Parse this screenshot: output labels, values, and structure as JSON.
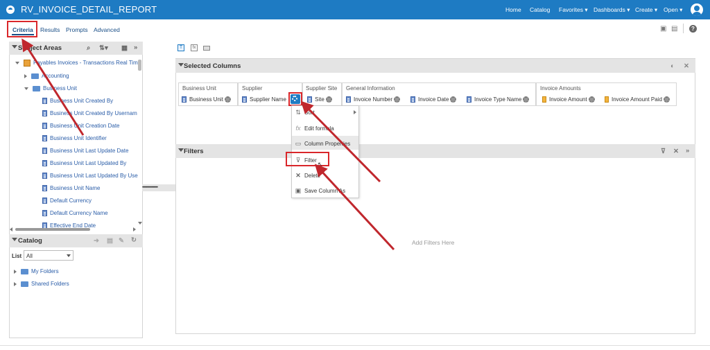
{
  "header": {
    "title": "RV_INVOICE_DETAIL_REPORT",
    "nav": [
      "Home",
      "Catalog",
      "Favorites ▾",
      "Dashboards ▾",
      "Create ▾",
      "Open ▾"
    ]
  },
  "tabs": [
    "Criteria",
    "Results",
    "Prompts",
    "Advanced"
  ],
  "subject_areas": {
    "title": "Subject Areas",
    "root": "Payables Invoices - Transactions Real Tim",
    "items": [
      {
        "label": "Accounting",
        "type": "folder",
        "expanded": false
      },
      {
        "label": "Business Unit",
        "type": "folder",
        "expanded": true
      },
      {
        "label": "Business Unit Created By",
        "type": "column"
      },
      {
        "label": "Business Unit Created By Usernam",
        "type": "column"
      },
      {
        "label": "Business Unit Creation Date",
        "type": "column"
      },
      {
        "label": "Business Unit Identifier",
        "type": "column"
      },
      {
        "label": "Business Unit Last Update Date",
        "type": "column"
      },
      {
        "label": "Business Unit Last Updated By",
        "type": "column"
      },
      {
        "label": "Business Unit Last Updated By Use",
        "type": "column"
      },
      {
        "label": "Business Unit Name",
        "type": "column"
      },
      {
        "label": "Default Currency",
        "type": "column"
      },
      {
        "label": "Default Currency Name",
        "type": "column"
      },
      {
        "label": "Effective End Date",
        "type": "column"
      }
    ]
  },
  "catalog": {
    "title": "Catalog",
    "list_label": "List",
    "list_value": "All",
    "folders": [
      "My Folders",
      "Shared Folders"
    ]
  },
  "selected_columns": {
    "title": "Selected Columns",
    "groups": [
      {
        "name": "Business Unit",
        "columns": [
          "Business Unit"
        ]
      },
      {
        "name": "Supplier",
        "columns": [
          "Supplier Name"
        ]
      },
      {
        "name": "Supplier Site",
        "columns": [
          "Site"
        ]
      },
      {
        "name": "General Information",
        "columns": [
          "Invoice Number",
          "Invoice Date",
          "Invoice Type Name"
        ]
      },
      {
        "name": "Invoice Amounts",
        "columns": [
          "Invoice Amount",
          "Invoice Amount Paid"
        ]
      }
    ]
  },
  "context_menu": {
    "items": [
      "Sort",
      "Edit formula",
      "Column Properties",
      "Filter",
      "Delete",
      "Save Column As"
    ]
  },
  "filters": {
    "title": "Filters",
    "placeholder": "Add Filters Here"
  },
  "colors": {
    "header_bg": "#1e7bc3",
    "highlight_red": "#d9262a",
    "link_blue": "#2a5da8"
  }
}
